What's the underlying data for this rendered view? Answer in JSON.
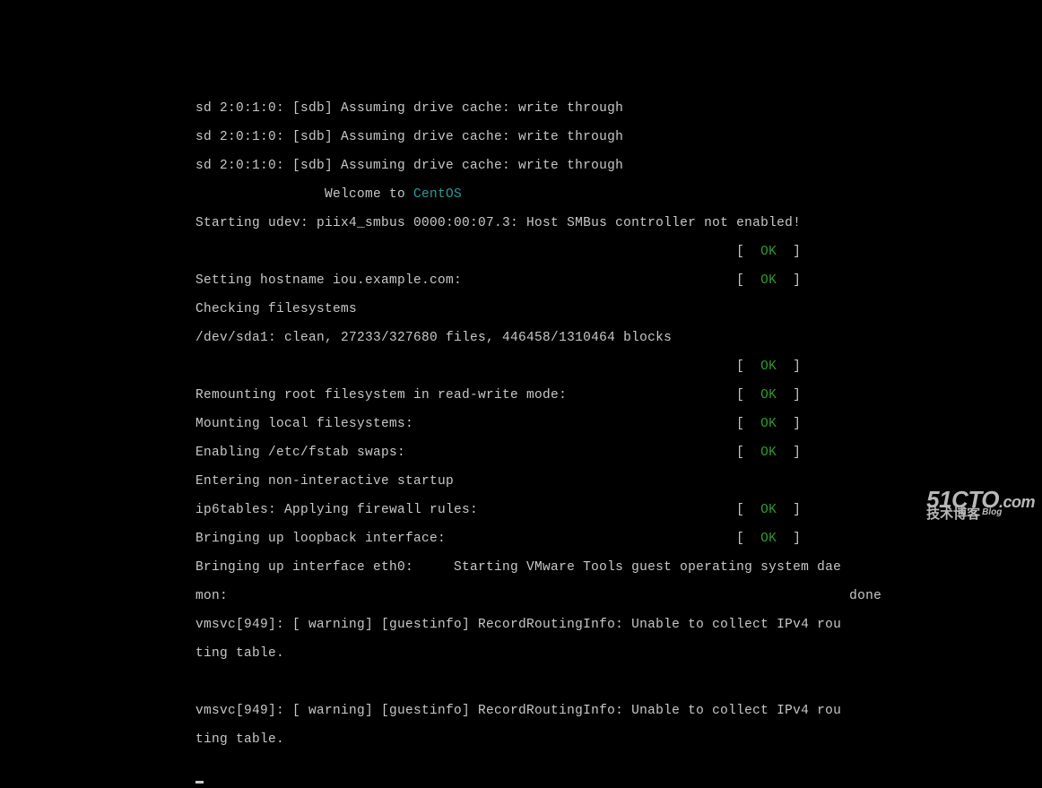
{
  "boot": {
    "sdb1": "sd 2:0:1:0: [sdb] Assuming drive cache: write through",
    "sdb2": "sd 2:0:1:0: [sdb] Assuming drive cache: write through",
    "sdb3": "sd 2:0:1:0: [sdb] Assuming drive cache: write through",
    "welcome_prefix": "                Welcome to ",
    "welcome_os": "CentOS",
    "udev": "Starting udev: piix4_smbus 0000:00:07.3: Host SMBus controller not enabled!",
    "ok_only_lb": "                                                                   [  ",
    "ok_only_ok": "OK",
    "ok_only_rb": "  ]",
    "hostname_l": "Setting hostname iou.example.com:                                  [  ",
    "hostname_r": "  ]",
    "checkfs": "Checking filesystems",
    "sda1": "/dev/sda1: clean, 27233/327680 files, 446458/1310464 blocks",
    "remount_l": "Remounting root filesystem in read-write mode:                     [  ",
    "remount_r": "  ]",
    "mount_l": "Mounting local filesystems:                                        [  ",
    "mount_r": "  ]",
    "swap_l": "Enabling /etc/fstab swaps:                                         [  ",
    "swap_r": "  ]",
    "nonint": "Entering non-interactive startup",
    "ip6_l": "ip6tables: Applying firewall rules:                                [  ",
    "ip6_r": "  ]",
    "lo_l": "Bringing up loopback interface:                                    [  ",
    "lo_r": "  ]",
    "eth0": "Bringing up interface eth0:     Starting VMware Tools guest operating system dae",
    "eth0b": "mon:                                                                             done",
    "vmsvc1a": "vmsvc[949]: [ warning] [guestinfo] RecordRoutingInfo: Unable to collect IPv4 rou",
    "vmsvc1b": "ting table.",
    "vmsvc2a": "vmsvc[949]: [ warning] [guestinfo] RecordRoutingInfo: Unable to collect IPv4 rou",
    "vmsvc2b": "ting table."
  },
  "status": {
    "ok": "OK"
  },
  "watermark": {
    "domain": "51CTO",
    "tld": ".com",
    "sub": "技术博客",
    "blog": "Blog"
  }
}
